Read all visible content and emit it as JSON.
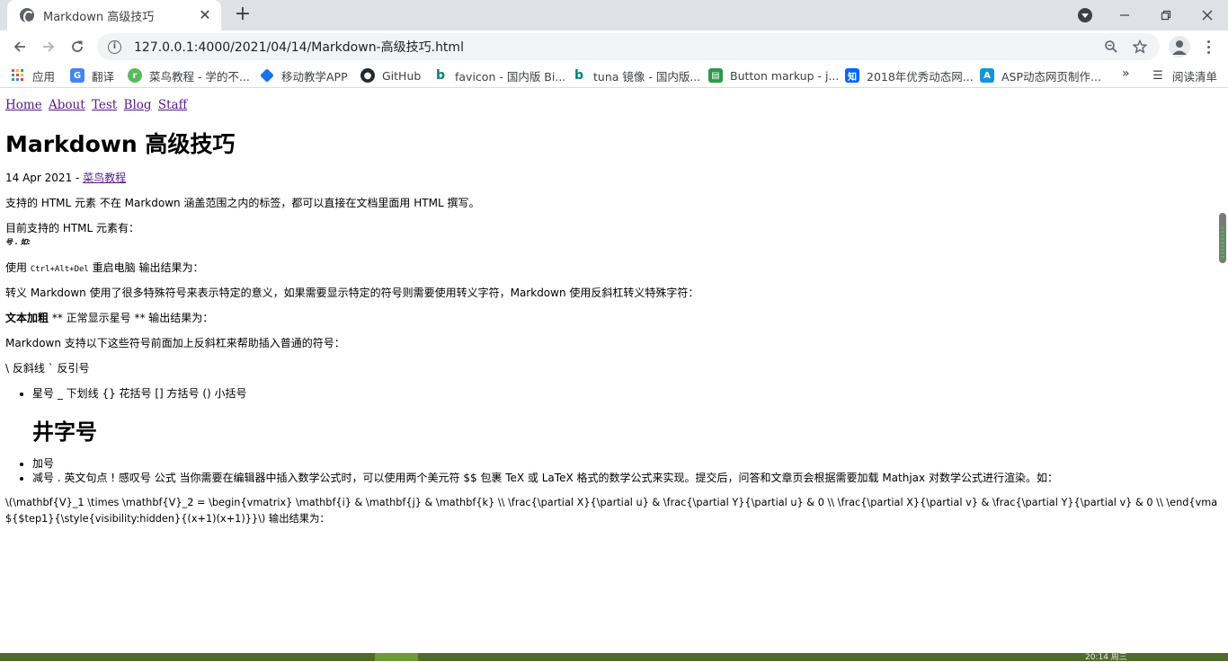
{
  "browser": {
    "tab_title": "Markdown 高级技巧",
    "tab_close": "✕",
    "new_tab": "+",
    "url": "127.0.0.1:4000/2021/04/14/Markdown-高级技巧.html",
    "info_glyph": "i",
    "bookmarks": [
      {
        "label": "应用",
        "icon": "apps-icon",
        "color": "#e94235"
      },
      {
        "label": "翻译",
        "icon": "translate-icon",
        "color": "#4285f4"
      },
      {
        "label": "菜鸟教程 - 学的不...",
        "icon": "runoob-icon",
        "color": "#5cb85c"
      },
      {
        "label": "移动教学APP",
        "icon": "mobile-teaching-icon",
        "color": "#1a73e8"
      },
      {
        "label": "GitHub",
        "icon": "github-icon",
        "color": "#24292e"
      },
      {
        "label": "favicon - 国内版 Bi...",
        "icon": "bing-icon",
        "color": "#008373"
      },
      {
        "label": "tuna 镜像 - 国内版...",
        "icon": "bing-icon",
        "color": "#008373"
      },
      {
        "label": "Button markup - j...",
        "icon": "jquery-icon",
        "color": "#2b9a47"
      },
      {
        "label": "2018年优秀动态网...",
        "icon": "zhihu-icon",
        "color": "#0066ff"
      },
      {
        "label": "ASP动态网页制作...",
        "icon": "asp-icon",
        "color": "#1296db"
      }
    ],
    "bookmarks_more": "»",
    "reading_list": "阅读清单"
  },
  "page": {
    "nav": [
      "Home",
      "About",
      "Test",
      "Blog",
      "Staff"
    ],
    "title": "Markdown 高级技巧",
    "date": "14 Apr 2021 - ",
    "category": "菜鸟教程",
    "p1": "支持的 HTML 元素 不在 Markdown 涵盖范围之内的标签，都可以直接在文档里面用 HTML 撰写。",
    "p2": "目前支持的 HTML 元素有：",
    "p2_small": "号 . 如:",
    "p3_prefix": "使用 ",
    "p3_code": "Ctrl+Alt+Del",
    "p3_suffix": " 重启电脑 输出结果为：",
    "p4": "转义 Markdown 使用了很多特殊符号来表示特定的意义，如果需要显示特定的符号则需要使用转义字符，Markdown 使用反斜杠转义特殊字符：",
    "p5_bold": "文本加粗",
    "p5_rest": " ** 正常显示星号 ** 输出结果为：",
    "p6": "Markdown 支持以下这些符号前面加上反斜杠来帮助插入普通的符号：",
    "p7": "\\ 反斜线 ` 反引号",
    "list1": [
      "星号 _ 下划线 {} 花括号 [] 方括号 () 小括号"
    ],
    "h2": "井字号",
    "list2": [
      "加号",
      "减号 . 英文句点 ! 感叹号 公式 当你需要在编辑器中插入数学公式时，可以使用两个美元符 $$ 包裹 TeX 或 LaTeX 格式的数学公式来实现。提交后，问答和文章页会根据需要加载 Mathjax 对数学公式进行渲染。如："
    ],
    "p8": "\\(\\mathbf{V}_1 \\times \\mathbf{V}_2 = \\begin{vmatrix} \\mathbf{i} & \\mathbf{j} & \\mathbf{k} \\\\ \\frac{\\partial X}{\\partial u} & \\frac{\\partial Y}{\\partial u} & 0 \\\\ \\frac{\\partial X}{\\partial v} & \\frac{\\partial Y}{\\partial v} & 0 \\\\ \\end{vmatrix}",
    "p9": "${$tep1}{\\style{visibility:hidden}{(x+1)(x+1)}}\\) 输出结果为："
  },
  "taskbar": {
    "clock": "20:14 周三"
  }
}
